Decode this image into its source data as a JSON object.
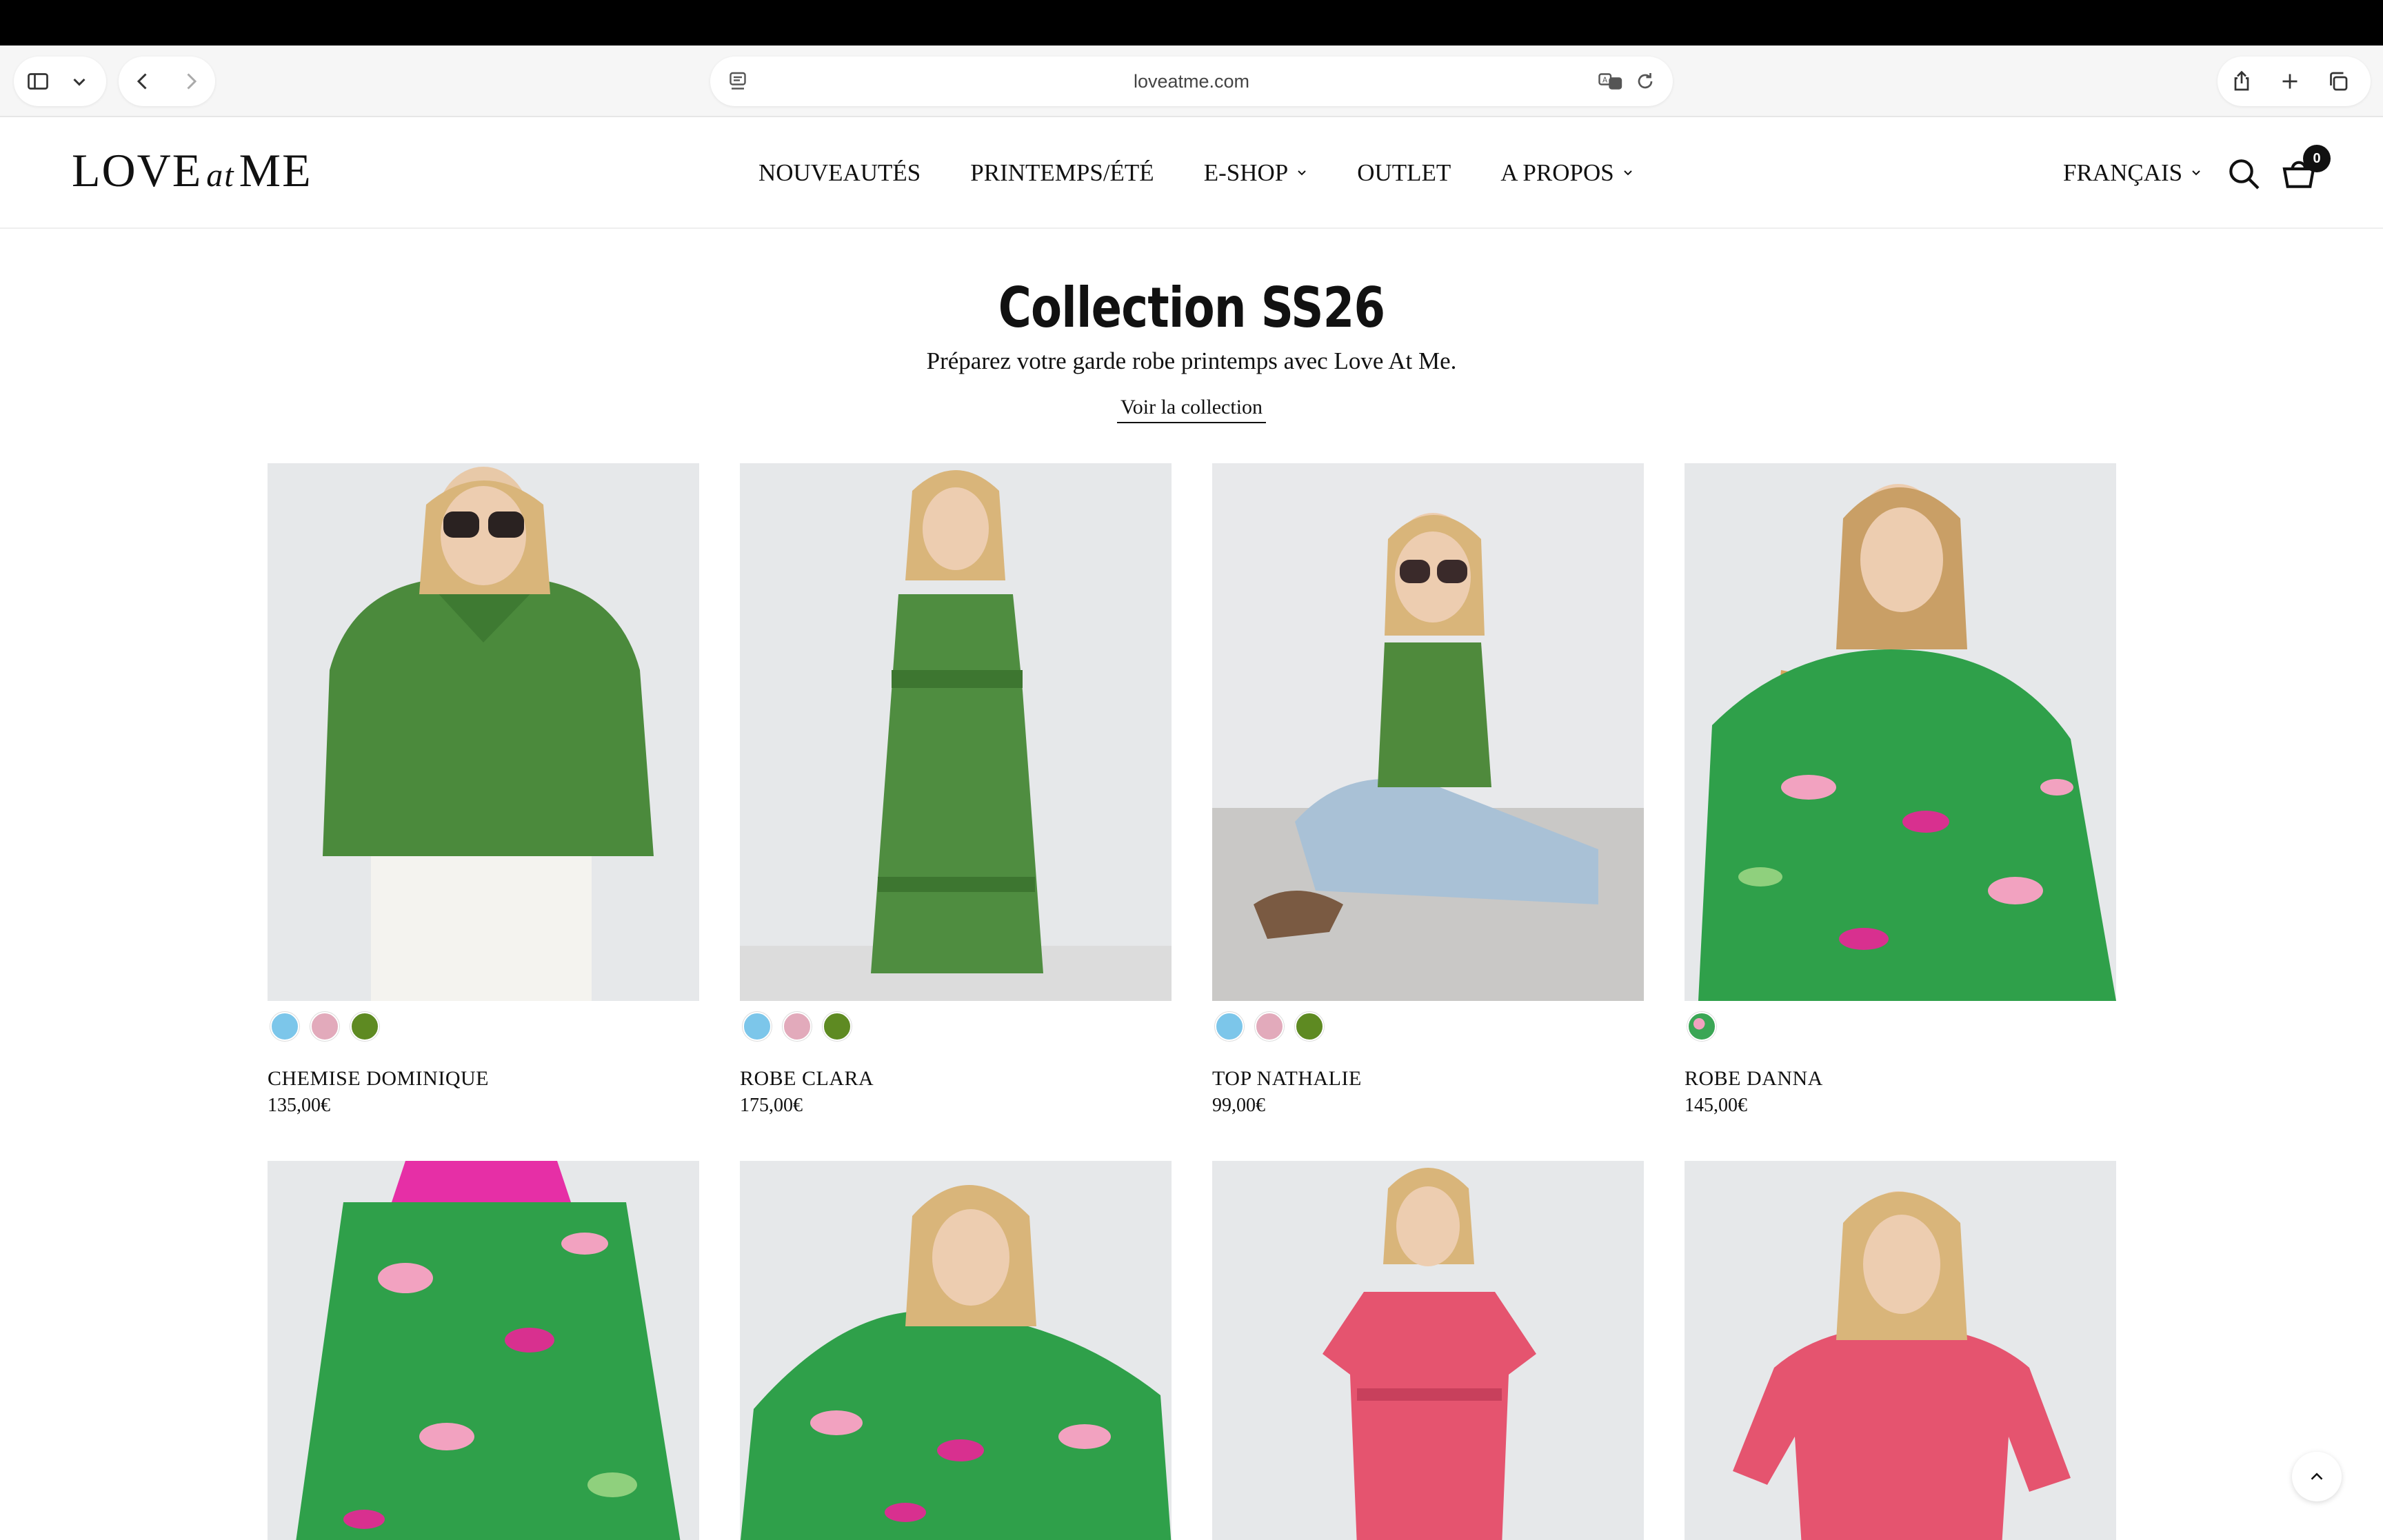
{
  "browser": {
    "url": "loveatme.com"
  },
  "site": {
    "logo_left": "LOVE",
    "logo_mid": "at",
    "logo_right": "ME",
    "nav": [
      {
        "label": "NOUVEAUTÉS"
      },
      {
        "label": "PRINTEMPS/ÉTÉ"
      },
      {
        "label": "E-SHOP"
      },
      {
        "label": "OUTLET"
      },
      {
        "label": "A PROPOS"
      }
    ],
    "language": "FRANÇAIS",
    "cart_count": "0"
  },
  "hero": {
    "title": "Collection SS26",
    "subtitle": "Préparez votre garde robe printemps avec Love At Me.",
    "link": "Voir la collection"
  },
  "products": [
    {
      "name": "CHEMISE DOMINIQUE",
      "price": "135,00€",
      "swatches": [
        "#7cc6ea",
        "#e2aabb",
        "#5e8a22"
      ]
    },
    {
      "name": "ROBE CLARA",
      "price": "175,00€",
      "swatches": [
        "#7cc6ea",
        "#e2aabb",
        "#5e8a22"
      ]
    },
    {
      "name": "TOP NATHALIE",
      "price": "99,00€",
      "swatches": [
        "#7cc6ea",
        "#e2aabb",
        "#5e8a22"
      ]
    },
    {
      "name": "ROBE DANNA",
      "price": "145,00€",
      "swatches": [
        "#3aa655"
      ]
    }
  ],
  "icons": {
    "sidebar": "sidebar-icon",
    "back": "chevron-left-icon",
    "forward": "chevron-right-icon",
    "share": "share-icon",
    "new_tab": "plus-icon",
    "tabs": "tabs-icon",
    "search": "search-icon",
    "cart": "basket-icon",
    "scroll_top": "chevron-up-icon"
  },
  "colors": {
    "brand_text": "#111111",
    "image_bg": "#e7e8ea",
    "green": "#3f9a3d",
    "pink": "#e1577a"
  }
}
